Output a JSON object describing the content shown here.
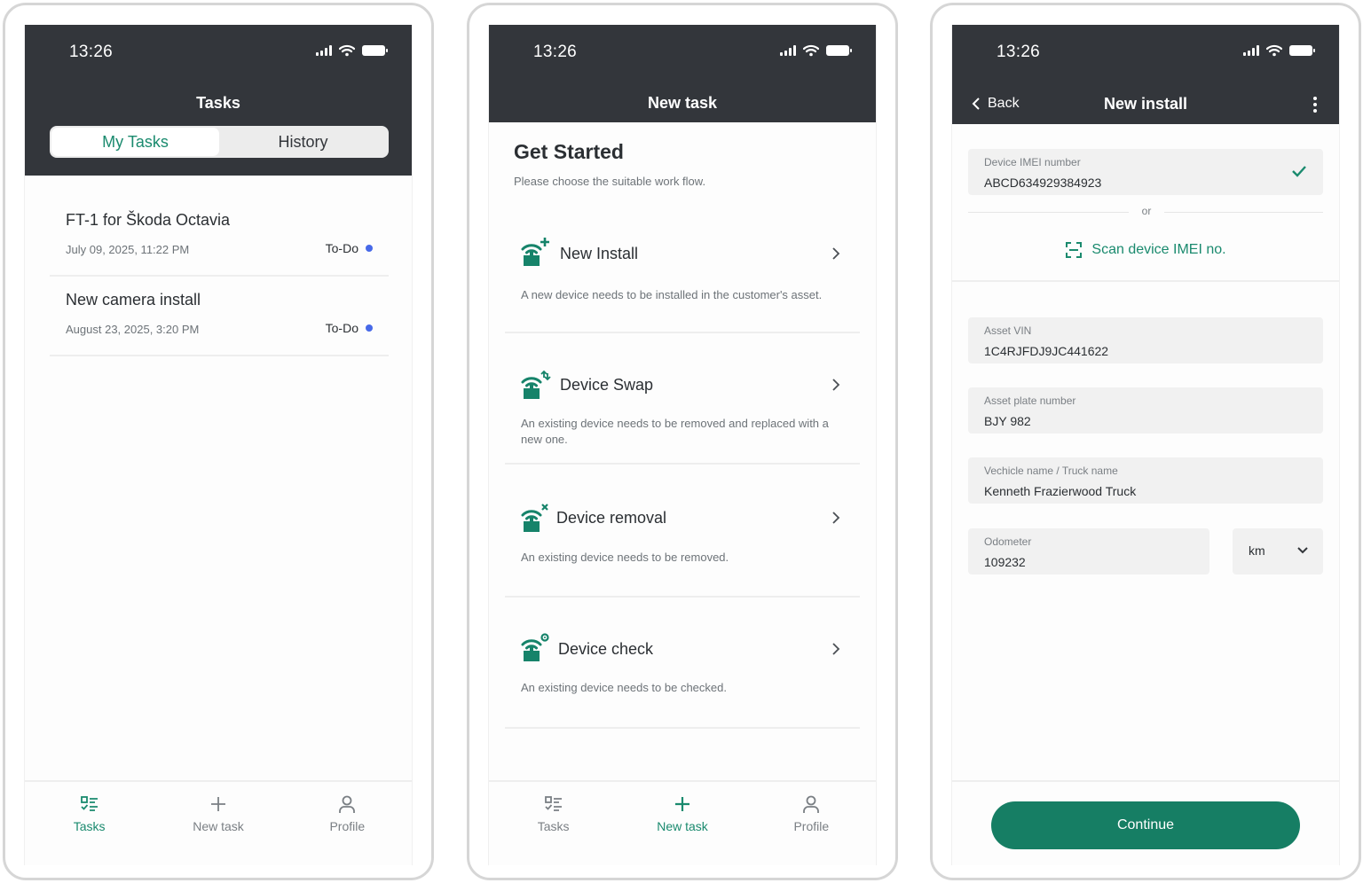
{
  "colors": {
    "header_bg": "#33363b",
    "accent": "#1a8a6e",
    "button": "#167e64",
    "todo_dot": "#4769e8"
  },
  "status_bar": {
    "time": "13:26"
  },
  "screen1": {
    "title": "Tasks",
    "tabs": [
      "My Tasks",
      "History"
    ],
    "active_tab": "My Tasks",
    "tasks": [
      {
        "title": "FT-1 for Škoda Octavia",
        "date": "July 09, 2025, 11:22 PM",
        "status": "To-Do"
      },
      {
        "title": "New camera install",
        "date": "August 23, 2025, 3:20 PM",
        "status": "To-Do"
      }
    ]
  },
  "screen2": {
    "title": "New task",
    "heading": "Get Started",
    "subheading": "Please choose the suitable work flow.",
    "flows": [
      {
        "name": "New Install",
        "icon": "wifi-plus-icon",
        "description": "A new device needs to be installed in the customer's asset."
      },
      {
        "name": "Device Swap",
        "icon": "wifi-swap-icon",
        "description": "An existing device needs to be removed and replaced with a new one."
      },
      {
        "name": "Device removal",
        "icon": "wifi-remove-icon",
        "description": "An existing device needs to be removed."
      },
      {
        "name": "Device check",
        "icon": "wifi-gear-icon",
        "description": "An existing device needs to be checked."
      }
    ]
  },
  "screen3": {
    "title": "New install",
    "back_label": "Back",
    "imei": {
      "label": "Device IMEI number",
      "value": "ABCD634929384923"
    },
    "or_text": "or",
    "scan_label": "Scan device IMEI no.",
    "vin": {
      "label": "Asset VIN",
      "value": "1C4RJFDJ9JC441622"
    },
    "plate": {
      "label": "Asset plate number",
      "value": "BJY 982"
    },
    "vehicle": {
      "label": "Vechicle name / Truck name",
      "value": "Kenneth Frazierwood Truck"
    },
    "odometer": {
      "label": "Odometer",
      "value": "109232"
    },
    "unit": {
      "selected": "km"
    },
    "continue_label": "Continue"
  },
  "nav": {
    "items": [
      {
        "label": "Tasks",
        "icon": "tasks-icon"
      },
      {
        "label": "New task",
        "icon": "plus-icon"
      },
      {
        "label": "Profile",
        "icon": "person-icon"
      }
    ]
  }
}
